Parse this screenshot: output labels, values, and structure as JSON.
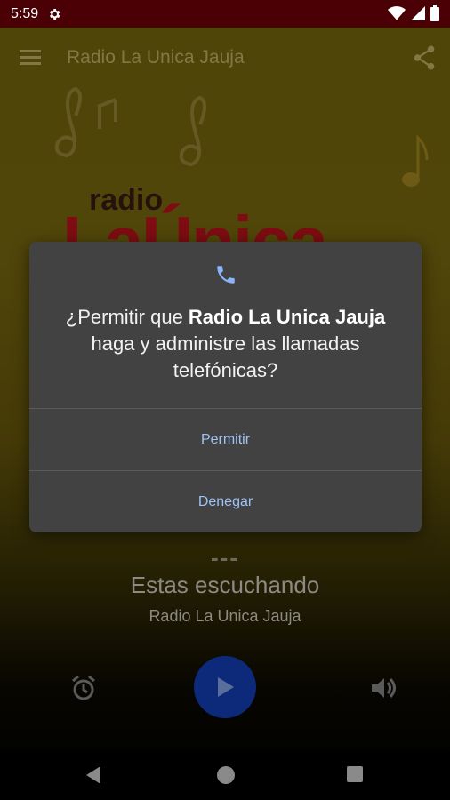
{
  "status_bar": {
    "time": "5:59"
  },
  "toolbar": {
    "title": "Radio La Unica Jauja"
  },
  "logo": {
    "top_word": "radio",
    "main_word": "LaÚnica"
  },
  "dialog": {
    "question_before": "¿Permitir que ",
    "app_name": "Radio La Unica Jauja",
    "question_after": " haga y administre las llamadas telefónicas?",
    "allow_label": "Permitir",
    "deny_label": "Denegar"
  },
  "player": {
    "dashes": "---",
    "listening_label": "Estas escuchando",
    "station_name": "Radio La Unica Jauja"
  },
  "icons": {
    "menu": "menu-icon",
    "share": "share-icon",
    "phone": "phone-icon",
    "alarm": "alarm-icon",
    "play": "play-icon",
    "volume": "volume-icon"
  },
  "colors": {
    "status_bar": "#4a0005",
    "dialog_bg": "#424242",
    "dialog_button": "#9ec3f5",
    "play_button": "#0d2a7a"
  }
}
